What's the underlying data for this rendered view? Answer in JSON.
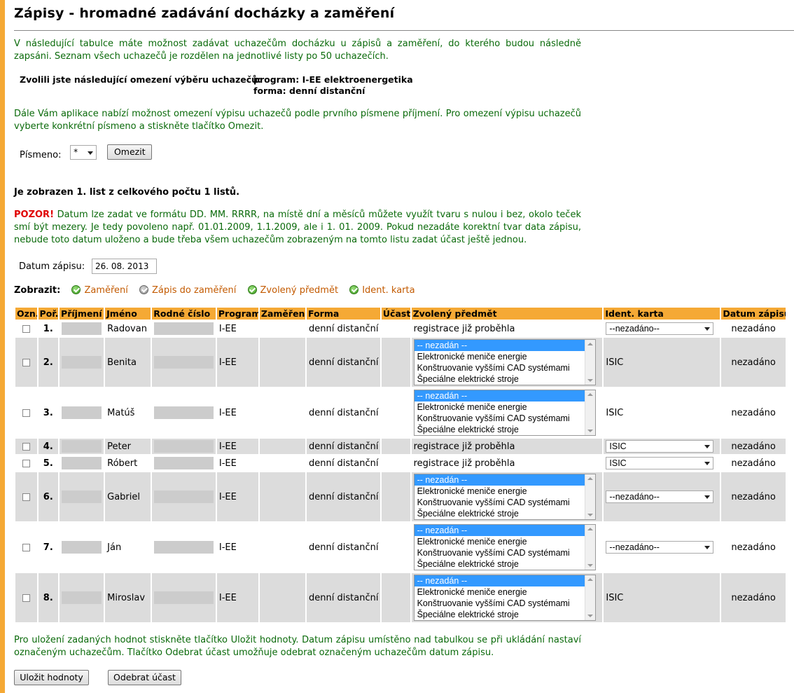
{
  "page": {
    "title": "Zápisy - hromadné zadávání docházky a zaměření",
    "intro": "V následující tabulce máte možnost zadávat uchazečům docházku u zápisů a zaměření, do kterého budou následně zapsáni. Seznam všech uchazečů je rozdělen na jednotlivé listy po 50 uchazečích.",
    "filter_label": "Zvolili jste následující omezení výběru uchazečů:",
    "filter_program": "program: I-EE elektroenergetika",
    "filter_forma": "forma: denní distanční",
    "letter_info": "Dále Vám aplikace nabízí možnost omezení výpisu uchazečů podle prvního písmene příjmení. Pro omezení výpisu uchazečů vyberte konkrétní písmeno a stiskněte tlačítko Omezit.",
    "pismeno_label": "Písmeno:",
    "pismeno_value": "*",
    "omezit_button": "Omezit",
    "list_info": "Je zobrazen 1. list z celkového počtu 1 listů.",
    "warning_prefix": "POZOR!",
    "warning_text": " Datum lze zadat ve formátu DD. MM. RRRR, na místě dní a měsíců můžete využít tvaru s nulou i bez, okolo teček smí být mezery. Je tedy povoleno např. 01.01.2009, 1.1.2009, ale i 1. 01. 2009. Pokud nezadáte korektní tvar data zápisu, nebude toto datum uloženo a bude třeba všem uchazečům zobrazeným na tomto listu zadat účast ještě jednou.",
    "datum_label": "Datum zápisu:",
    "datum_value": "26. 08. 2013",
    "legend_label": "Zobrazit:",
    "legend": [
      {
        "label": "Zaměření",
        "checked": true
      },
      {
        "label": "Zápis do zaměření",
        "checked": false
      },
      {
        "label": "Zvolený předmět",
        "checked": true
      },
      {
        "label": "Ident. karta",
        "checked": true
      }
    ],
    "footer_text": "Pro uložení zadaných hodnot stiskněte tlačítko Uložit hodnoty. Datum zápisu umístěno nad tabulkou se při ukládání nastaví označeným uchazečům. Tlačítko Odebrat účast umožňuje odebrat označeným uchazečům datum zápisu.",
    "save_button": "Uložit hodnoty",
    "remove_button": "Odebrat účast"
  },
  "colors": {
    "accent": "#f5a935",
    "text_green": "#0a6a0a",
    "warning_red": "#e00000",
    "legend_orange": "#c35a00",
    "row_gray": "#dcdcdc"
  },
  "table": {
    "headers": [
      "Ozn.",
      "Poř.",
      "Příjmení",
      "Jméno",
      "Rodné číslo",
      "Program",
      "Zaměření",
      "Forma",
      "Účast",
      "Zvolený předmět",
      "Ident. karta",
      "Datum zápisu"
    ],
    "subject_options": [
      "-- nezadán --",
      "Elektronické meniče energie",
      "Konštruovanie vyššími CAD systémami",
      "Špeciálne elektrické stroje"
    ],
    "rows": [
      {
        "num": "1.",
        "jmeno": "Radovan",
        "program": "I-EE",
        "forma": "denní distanční",
        "predmet_type": "text",
        "predmet_text": "registrace již proběhla",
        "karta_type": "select",
        "karta": "--nezadáno--",
        "datum": "nezadáno"
      },
      {
        "num": "2.",
        "jmeno": "Benita",
        "program": "I-EE",
        "forma": "denní distanční",
        "predmet_type": "list",
        "predmet_text": "",
        "karta_type": "text",
        "karta": "ISIC",
        "datum": "nezadáno"
      },
      {
        "num": "3.",
        "jmeno": "Matúš",
        "program": "I-EE",
        "forma": "denní distanční",
        "predmet_type": "list",
        "predmet_text": "",
        "karta_type": "text",
        "karta": "ISIC",
        "datum": "nezadáno"
      },
      {
        "num": "4.",
        "jmeno": "Peter",
        "program": "I-EE",
        "forma": "denní distanční",
        "predmet_type": "text",
        "predmet_text": "registrace již proběhla",
        "karta_type": "select",
        "karta": "ISIC",
        "datum": "nezadáno"
      },
      {
        "num": "5.",
        "jmeno": "Róbert",
        "program": "I-EE",
        "forma": "denní distanční",
        "predmet_type": "text",
        "predmet_text": "registrace již proběhla",
        "karta_type": "select",
        "karta": "ISIC",
        "datum": "nezadáno"
      },
      {
        "num": "6.",
        "jmeno": "Gabriel",
        "program": "I-EE",
        "forma": "denní distanční",
        "predmet_type": "list",
        "predmet_text": "",
        "karta_type": "select",
        "karta": "--nezadáno--",
        "datum": "nezadáno"
      },
      {
        "num": "7.",
        "jmeno": "Ján",
        "program": "I-EE",
        "forma": "denní distanční",
        "predmet_type": "list",
        "predmet_text": "",
        "karta_type": "select",
        "karta": "--nezadáno--",
        "datum": "nezadáno"
      },
      {
        "num": "8.",
        "jmeno": "Miroslav",
        "program": "I-EE",
        "forma": "denní distanční",
        "predmet_type": "list",
        "predmet_text": "",
        "karta_type": "text",
        "karta": "ISIC",
        "datum": "nezadáno"
      }
    ]
  }
}
